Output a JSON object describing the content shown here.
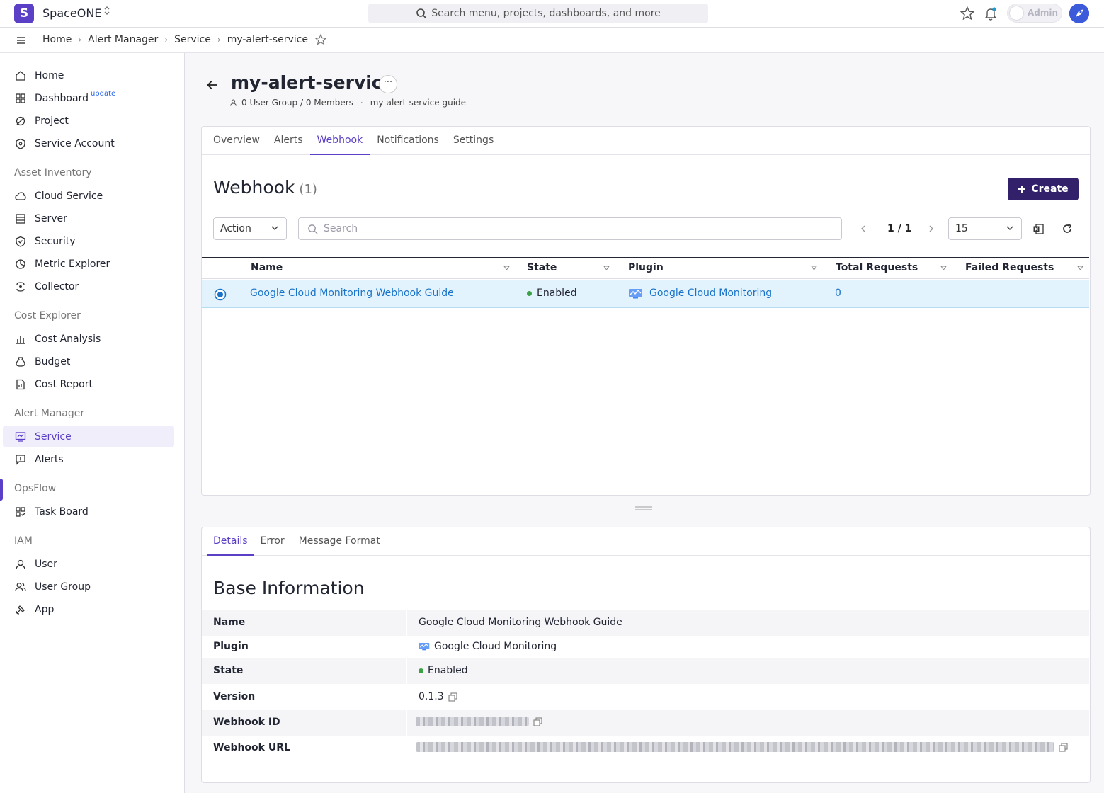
{
  "app": {
    "name": "SpaceONE",
    "logo_letter": "S"
  },
  "topbar": {
    "search_placeholder": "Search menu, projects, dashboards, and more",
    "mode_label": "Admin",
    "accent": "#5b3fc7"
  },
  "breadcrumb": [
    "Home",
    "Alert Manager",
    "Service",
    "my-alert-service"
  ],
  "sidebar": {
    "top_items": [
      {
        "label": "Home",
        "icon": "home-icon"
      },
      {
        "label": "Dashboard",
        "badge": "update",
        "icon": "dashboard-icon"
      },
      {
        "label": "Project",
        "icon": "project-icon"
      },
      {
        "label": "Service Account",
        "icon": "shield-key-icon"
      }
    ],
    "sections": [
      {
        "title": "Asset Inventory",
        "items": [
          "Cloud Service",
          "Server",
          "Security",
          "Metric Explorer",
          "Collector"
        ]
      },
      {
        "title": "Cost Explorer",
        "items": [
          "Cost Analysis",
          "Budget",
          "Cost Report"
        ]
      },
      {
        "title": "Alert Manager",
        "items": [
          "Service",
          "Alerts"
        ]
      },
      {
        "title": "OpsFlow",
        "items": [
          "Task Board"
        ]
      },
      {
        "title": "IAM",
        "items": [
          "User",
          "User Group",
          "App"
        ]
      }
    ],
    "active": "Service"
  },
  "page": {
    "title": "my-alert-service",
    "more_label": "···",
    "meta_groups": "0 User Group / 0 Members",
    "meta_guide": "my-alert-service guide"
  },
  "tabs": [
    "Overview",
    "Alerts",
    "Webhook",
    "Notifications",
    "Settings"
  ],
  "active_tab": "Webhook",
  "webhook": {
    "title": "Webhook",
    "count": "(1)",
    "create_label": "Create",
    "action_label": "Action",
    "search_placeholder": "Search",
    "page_indicator": "1 / 1",
    "page_size": "15",
    "columns": [
      "Name",
      "State",
      "Plugin",
      "Total Requests",
      "Failed Requests"
    ],
    "rows": [
      {
        "name": "Google Cloud Monitoring Webhook Guide",
        "state": "Enabled",
        "plugin": "Google Cloud Monitoring",
        "total_requests": "0",
        "failed_requests": ""
      }
    ]
  },
  "details": {
    "tabs": [
      "Details",
      "Error",
      "Message Format"
    ],
    "active_tab": "Details",
    "title": "Base Information",
    "fields": {
      "name": {
        "key": "Name",
        "value": "Google Cloud Monitoring Webhook Guide"
      },
      "plugin": {
        "key": "Plugin",
        "value": "Google Cloud Monitoring"
      },
      "state": {
        "key": "State",
        "value": "Enabled"
      },
      "version": {
        "key": "Version",
        "value": "0.1.3"
      },
      "webhook_id": {
        "key": "Webhook ID"
      },
      "webhook_url": {
        "key": "Webhook URL"
      }
    }
  },
  "colors": {
    "accent": "#5b3fc7",
    "primary_dark": "#33206a",
    "link": "#1a73c8",
    "enabled": "#3ba145",
    "selected_row": "#e3f3fd"
  }
}
